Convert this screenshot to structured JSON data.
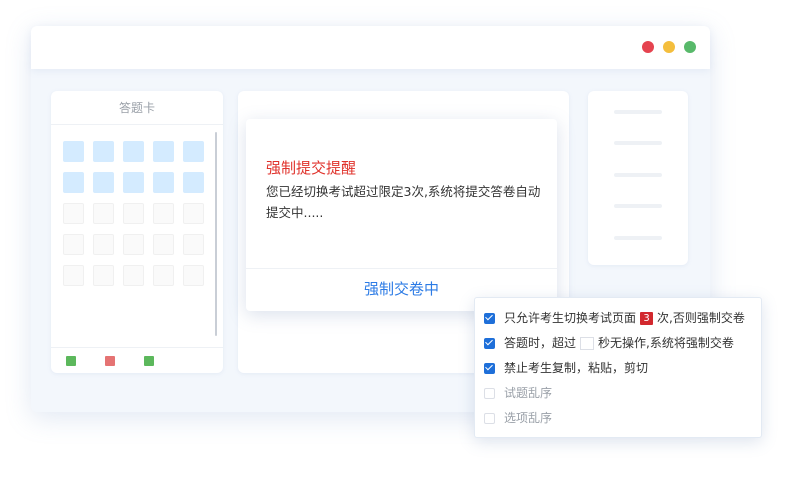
{
  "window": {
    "dots": [
      {
        "name": "close",
        "color": "#e5434f"
      },
      {
        "name": "minimize",
        "color": "#f4be3d"
      },
      {
        "name": "maximize",
        "color": "#58b96a"
      }
    ]
  },
  "answer_card": {
    "title": "答题卡",
    "rows_answered": 2,
    "rows_empty": 3,
    "columns": 5,
    "legend_colors": [
      "#5cb85c",
      "#e57373",
      "#5cb85c"
    ]
  },
  "modal": {
    "title": "强制提交提醒",
    "message": "您已经切换考试超过限定3次,系统将提交答卷自动提交中.....",
    "action": "强制交卷中"
  },
  "options": [
    {
      "checked": true,
      "before": "只允许考生切换考试页面",
      "badge": "3",
      "after": "次,否则强制交卷"
    },
    {
      "checked": true,
      "before": "答题时，超过",
      "input": "",
      "after": "秒无操作,系统将强制交卷"
    },
    {
      "checked": true,
      "text": "禁止考生复制，粘贴，剪切"
    },
    {
      "checked": false,
      "text": "试题乱序"
    },
    {
      "checked": false,
      "text": "选项乱序"
    }
  ],
  "colors": {
    "accent": "#2c7be5",
    "alert": "#e0322b",
    "checkbox": "#1e6fd9",
    "answered_cell": "#d4ebff"
  }
}
